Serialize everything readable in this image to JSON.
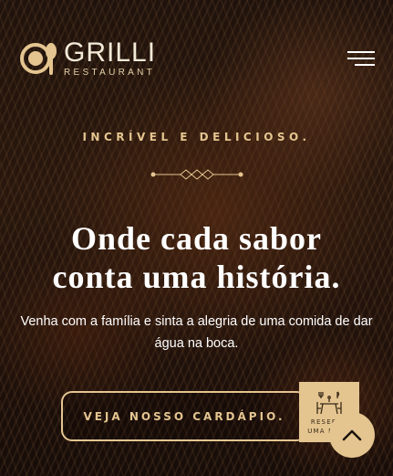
{
  "brand": {
    "name": "GRILLI",
    "subtitle": "RESTAURANT"
  },
  "hero": {
    "tagline": "INCRÍVEL E DELICIOSO.",
    "title_line1": "Onde cada sabor",
    "title_line2": "conta uma história.",
    "subtitle": "Venha com a família e sinta a alegria de uma comida de dar água na boca.",
    "cta_label": "VEJA NOSSO CARDÁPIO."
  },
  "book_badge": {
    "label": "RESERVE UMA MESA",
    "icon": "dining-table-icon"
  },
  "icons": {
    "menu": "hamburger-menu-icon",
    "scroll_top": "chevron-up-icon",
    "logo": "plate-spoon-logo-icon"
  },
  "colors": {
    "accent": "#e4c590",
    "text": "#ffffff"
  }
}
